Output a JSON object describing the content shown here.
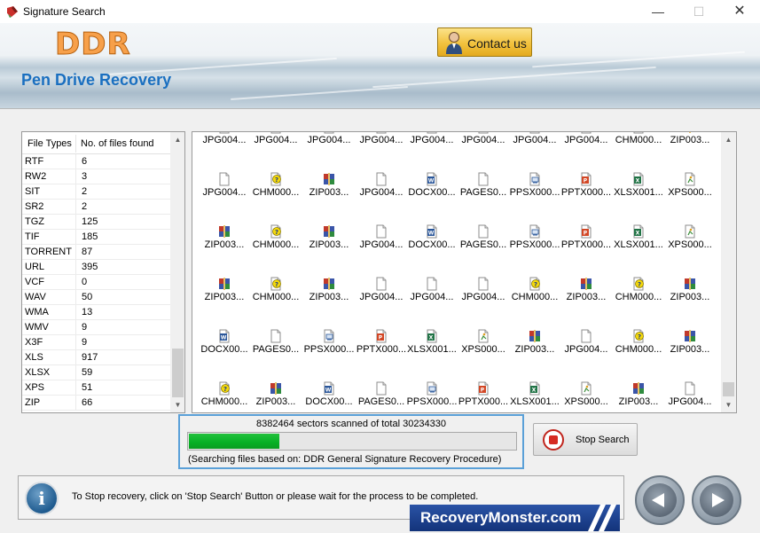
{
  "window": {
    "title": "Signature Search",
    "minimize": "—",
    "maximize": "☐",
    "close": "✕"
  },
  "header": {
    "logo": "DDR",
    "product": "Pen Drive Recovery",
    "contact_label": "Contact us"
  },
  "file_types": {
    "col_type": "File Types",
    "col_count": "No. of files found",
    "rows": [
      {
        "type": "RTF",
        "count": "6"
      },
      {
        "type": "RW2",
        "count": "3"
      },
      {
        "type": "SIT",
        "count": "2"
      },
      {
        "type": "SR2",
        "count": "2"
      },
      {
        "type": "TGZ",
        "count": "125"
      },
      {
        "type": "TIF",
        "count": "185"
      },
      {
        "type": "TORRENT",
        "count": "87"
      },
      {
        "type": "URL",
        "count": "395"
      },
      {
        "type": "VCF",
        "count": "0"
      },
      {
        "type": "WAV",
        "count": "50"
      },
      {
        "type": "WMA",
        "count": "13"
      },
      {
        "type": "WMV",
        "count": "9"
      },
      {
        "type": "X3F",
        "count": "9"
      },
      {
        "type": "XLS",
        "count": "917"
      },
      {
        "type": "XLSX",
        "count": "59"
      },
      {
        "type": "XPS",
        "count": "51"
      },
      {
        "type": "ZIP",
        "count": "66"
      }
    ]
  },
  "files": [
    [
      {
        "label": "JPG004...",
        "icon": "blank-file-icon"
      },
      {
        "label": "JPG004...",
        "icon": "blank-file-icon"
      },
      {
        "label": "JPG004...",
        "icon": "blank-file-icon"
      },
      {
        "label": "JPG004...",
        "icon": "blank-file-icon"
      },
      {
        "label": "JPG004...",
        "icon": "blank-file-icon"
      },
      {
        "label": "JPG004...",
        "icon": "blank-file-icon"
      },
      {
        "label": "JPG004...",
        "icon": "blank-file-icon"
      },
      {
        "label": "JPG004...",
        "icon": "blank-file-icon"
      },
      {
        "label": "CHM000...",
        "icon": "chm-help-icon"
      },
      {
        "label": "ZIP003...",
        "icon": "zip-archive-icon"
      }
    ],
    [
      {
        "label": "JPG004...",
        "icon": "blank-file-icon"
      },
      {
        "label": "CHM000...",
        "icon": "chm-help-icon"
      },
      {
        "label": "ZIP003...",
        "icon": "zip-archive-icon"
      },
      {
        "label": "JPG004...",
        "icon": "blank-file-icon"
      },
      {
        "label": "DOCX00...",
        "icon": "word-doc-icon"
      },
      {
        "label": "PAGES0...",
        "icon": "blank-file-icon"
      },
      {
        "label": "PPSX000...",
        "icon": "ppsx-icon"
      },
      {
        "label": "PPTX000...",
        "icon": "pptx-icon"
      },
      {
        "label": "XLSX001...",
        "icon": "excel-icon"
      },
      {
        "label": "XPS000...",
        "icon": "xps-icon"
      }
    ],
    [
      {
        "label": "ZIP003...",
        "icon": "zip-archive-icon"
      },
      {
        "label": "CHM000...",
        "icon": "chm-help-icon"
      },
      {
        "label": "ZIP003...",
        "icon": "zip-archive-icon"
      },
      {
        "label": "JPG004...",
        "icon": "blank-file-icon"
      },
      {
        "label": "DOCX00...",
        "icon": "word-doc-icon"
      },
      {
        "label": "PAGES0...",
        "icon": "blank-file-icon"
      },
      {
        "label": "PPSX000...",
        "icon": "ppsx-icon"
      },
      {
        "label": "PPTX000...",
        "icon": "pptx-icon"
      },
      {
        "label": "XLSX001...",
        "icon": "excel-icon"
      },
      {
        "label": "XPS000...",
        "icon": "xps-icon"
      }
    ],
    [
      {
        "label": "ZIP003...",
        "icon": "zip-archive-icon"
      },
      {
        "label": "CHM000...",
        "icon": "chm-help-icon"
      },
      {
        "label": "ZIP003...",
        "icon": "zip-archive-icon"
      },
      {
        "label": "JPG004...",
        "icon": "blank-file-icon"
      },
      {
        "label": "JPG004...",
        "icon": "blank-file-icon"
      },
      {
        "label": "JPG004...",
        "icon": "blank-file-icon"
      },
      {
        "label": "CHM000...",
        "icon": "chm-help-icon"
      },
      {
        "label": "ZIP003...",
        "icon": "zip-archive-icon"
      },
      {
        "label": "CHM000...",
        "icon": "chm-help-icon"
      },
      {
        "label": "ZIP003...",
        "icon": "zip-archive-icon"
      }
    ],
    [
      {
        "label": "DOCX00...",
        "icon": "word-doc-icon"
      },
      {
        "label": "PAGES0...",
        "icon": "blank-file-icon"
      },
      {
        "label": "PPSX000...",
        "icon": "ppsx-icon"
      },
      {
        "label": "PPTX000...",
        "icon": "pptx-icon"
      },
      {
        "label": "XLSX001...",
        "icon": "excel-icon"
      },
      {
        "label": "XPS000...",
        "icon": "xps-icon"
      },
      {
        "label": "ZIP003...",
        "icon": "zip-archive-icon"
      },
      {
        "label": "JPG004...",
        "icon": "blank-file-icon"
      },
      {
        "label": "CHM000...",
        "icon": "chm-help-icon"
      },
      {
        "label": "ZIP003...",
        "icon": "zip-archive-icon"
      }
    ],
    [
      {
        "label": "CHM000...",
        "icon": "chm-help-icon"
      },
      {
        "label": "ZIP003...",
        "icon": "zip-archive-icon"
      },
      {
        "label": "DOCX00...",
        "icon": "word-doc-icon"
      },
      {
        "label": "PAGES0...",
        "icon": "blank-file-icon"
      },
      {
        "label": "PPSX000...",
        "icon": "ppsx-icon"
      },
      {
        "label": "PPTX000...",
        "icon": "pptx-icon"
      },
      {
        "label": "XLSX001...",
        "icon": "excel-icon"
      },
      {
        "label": "XPS000...",
        "icon": "xps-icon"
      },
      {
        "label": "ZIP003...",
        "icon": "zip-archive-icon"
      },
      {
        "label": "JPG004...",
        "icon": "blank-file-icon"
      }
    ]
  ],
  "progress": {
    "status_text": "8382464 sectors scanned of total 30234330",
    "fraction": 0.277,
    "method_text": "(Searching files based on:  DDR General Signature Recovery Procedure)",
    "fill_color": "#06b025"
  },
  "stop_button": {
    "label": "Stop Search",
    "icon": "stop-icon"
  },
  "footer": {
    "message": "To Stop recovery, click on 'Stop Search' Button or please wait for the process to be completed.",
    "brand": "RecoveryMonster.com"
  },
  "colors": {
    "product_title": "#1a6fc0",
    "logo": "#f7a04a",
    "accent_border": "#5aa0d8"
  }
}
